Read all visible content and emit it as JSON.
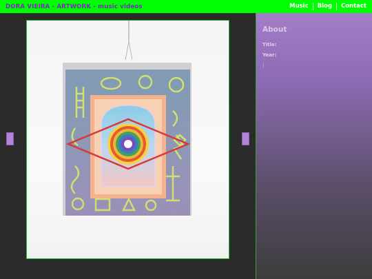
{
  "header": {
    "site_title": "DORA VIEIRA - ARTWORK - music videos",
    "nav": [
      "Music",
      "Blog",
      "Contact"
    ]
  },
  "about": {
    "heading": "About",
    "title_label": "Title:",
    "title_value": "",
    "year_label": "Year:",
    "year_value": "",
    "description": "|"
  },
  "colors": {
    "topbar": "#00ff00",
    "brand_text": "#7a2bbf",
    "frame_border": "#22c12a",
    "panel_top": "#a47dc9",
    "arrow": "#b085d6"
  },
  "icons": {
    "prev": "arrow-left",
    "next": "arrow-right"
  }
}
